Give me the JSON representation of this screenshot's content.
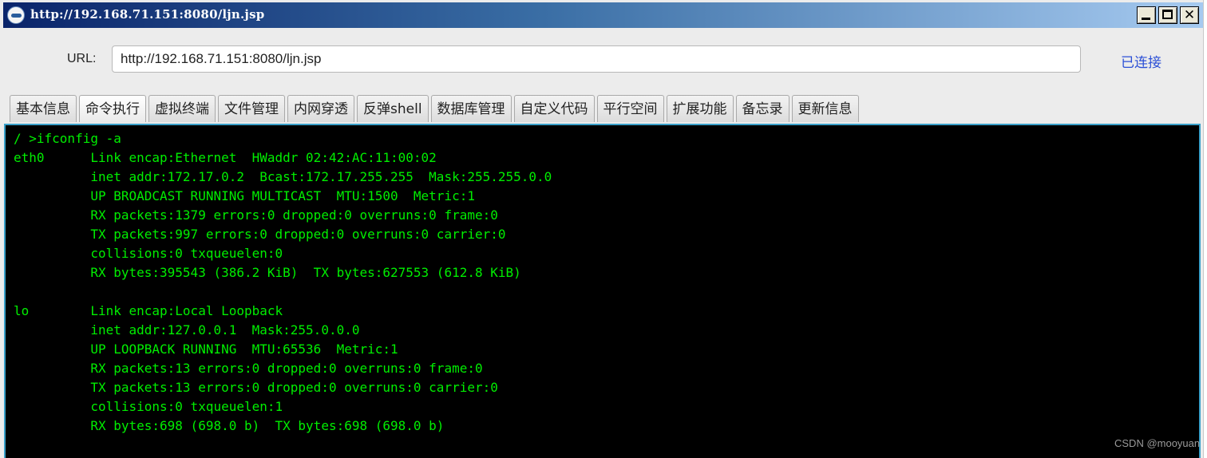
{
  "window": {
    "title": "http://192.168.71.151:8080/ljn.jsp",
    "app_icon": "globe-icon",
    "controls": {
      "minimize": "minimize-icon",
      "maximize": "maximize-icon",
      "close": "✕"
    }
  },
  "urlbar": {
    "label": "URL:",
    "value": "http://192.168.71.151:8080/ljn.jsp",
    "status": "已连接",
    "status_color": "#2b4fd6"
  },
  "tabs": [
    {
      "label": "基本信息",
      "active": false
    },
    {
      "label": "命令执行",
      "active": true
    },
    {
      "label": "虚拟终端",
      "active": false
    },
    {
      "label": "文件管理",
      "active": false
    },
    {
      "label": "内网穿透",
      "active": false
    },
    {
      "label": "反弹shell",
      "active": false
    },
    {
      "label": "数据库管理",
      "active": false
    },
    {
      "label": "自定义代码",
      "active": false
    },
    {
      "label": "平行空间",
      "active": false
    },
    {
      "label": "扩展功能",
      "active": false
    },
    {
      "label": "备忘录",
      "active": false
    },
    {
      "label": "更新信息",
      "active": false
    }
  ],
  "terminal": {
    "text_color": "#00ee00",
    "background": "#000000",
    "lines": [
      "/ >ifconfig -a",
      "eth0      Link encap:Ethernet  HWaddr 02:42:AC:11:00:02",
      "          inet addr:172.17.0.2  Bcast:172.17.255.255  Mask:255.255.0.0",
      "          UP BROADCAST RUNNING MULTICAST  MTU:1500  Metric:1",
      "          RX packets:1379 errors:0 dropped:0 overruns:0 frame:0",
      "          TX packets:997 errors:0 dropped:0 overruns:0 carrier:0",
      "          collisions:0 txqueuelen:0",
      "          RX bytes:395543 (386.2 KiB)  TX bytes:627553 (612.8 KiB)",
      "",
      "lo        Link encap:Local Loopback",
      "          inet addr:127.0.0.1  Mask:255.0.0.0",
      "          UP LOOPBACK RUNNING  MTU:65536  Metric:1",
      "          RX packets:13 errors:0 dropped:0 overruns:0 frame:0",
      "          TX packets:13 errors:0 dropped:0 overruns:0 carrier:0",
      "          collisions:0 txqueuelen:1",
      "          RX bytes:698 (698.0 b)  TX bytes:698 (698.0 b)"
    ]
  },
  "watermark": "CSDN @mooyuan"
}
